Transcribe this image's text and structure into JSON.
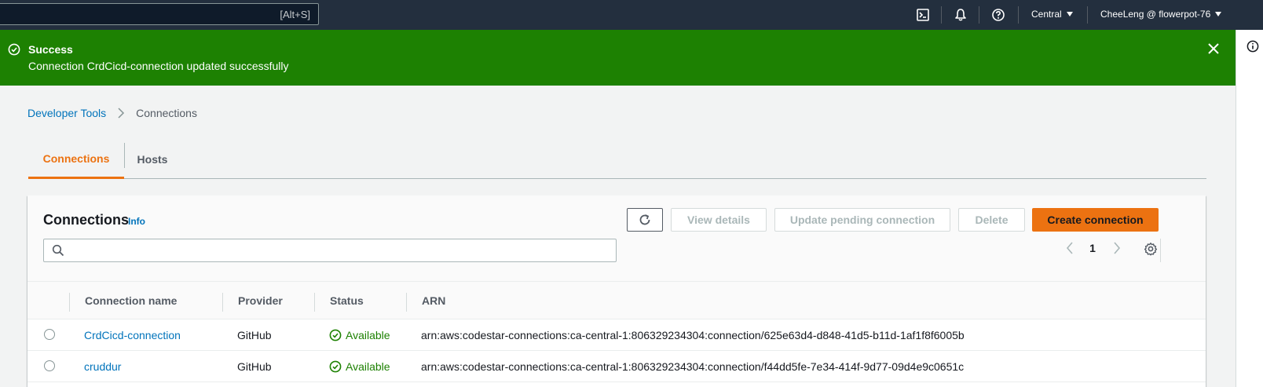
{
  "topnav": {
    "search_shortcut": "[Alt+S]",
    "region": "Central",
    "account": "CheeLeng @ flowerpot-76"
  },
  "flash": {
    "type": "success",
    "title": "Success",
    "message": "Connection CrdCicd-connection updated successfully"
  },
  "breadcrumb": {
    "items": [
      "Developer Tools",
      "Connections"
    ]
  },
  "tabs": [
    {
      "label": "Connections",
      "active": true
    },
    {
      "label": "Hosts",
      "active": false
    }
  ],
  "table": {
    "title": "Connections",
    "info_label": "Info",
    "buttons": {
      "view_details": "View details",
      "update_pending": "Update pending connection",
      "delete": "Delete",
      "create": "Create connection"
    },
    "filter_placeholder": "",
    "page": "1",
    "columns": [
      "Connection name",
      "Provider",
      "Status",
      "ARN"
    ],
    "rows": [
      {
        "name": "CrdCicd-connection",
        "provider": "GitHub",
        "status": "Available",
        "arn": "arn:aws:codestar-connections:ca-central-1:806329234304:connection/625e63d4-d848-41d5-b11d-1af1f8f6005b"
      },
      {
        "name": "cruddur",
        "provider": "GitHub",
        "status": "Available",
        "arn": "arn:aws:codestar-connections:ca-central-1:806329234304:connection/f44dd5fe-7e34-414f-9d77-09d4e9c0651c"
      }
    ]
  },
  "colors": {
    "nav_bg": "#232f3e",
    "success": "#1d8102",
    "accent": "#ec7211",
    "link": "#0073bb"
  }
}
